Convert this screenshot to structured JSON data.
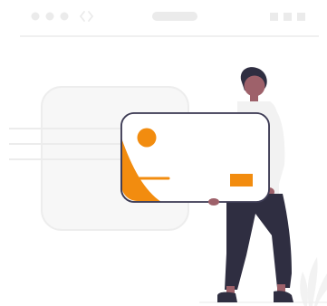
{
  "illustration": {
    "name": "credit-card-illustration",
    "colors": {
      "accent": "#f28c0f",
      "chrome_light": "#ebebeb",
      "chrome_mid": "#e4e4e4",
      "card_fill": "#ffffff",
      "card_stroke": "#3f3d56",
      "skin": "#9e616a",
      "hair": "#2f2e41",
      "shirt": "#f2f2f2",
      "pants": "#2f2e41",
      "shoes": "#2f2e41",
      "plant": "#f2f2f2"
    },
    "icons": {
      "window_controls": "three-dot-icon",
      "code_brackets": "code-brackets-icon",
      "address_bar": "address-bar-pill",
      "window_buttons": "three-square-icon"
    }
  }
}
